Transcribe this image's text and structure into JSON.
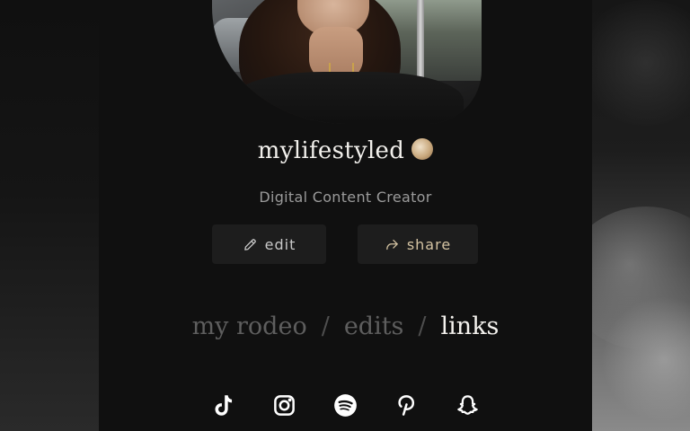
{
  "profile": {
    "username": "mylifestyled",
    "subtitle": "Digital Content Creator",
    "badge_icon": "sun-badge-icon",
    "photo": "profile-photo"
  },
  "actions": {
    "edit_label": "edit",
    "share_label": "share",
    "edit_icon": "pencil-icon",
    "share_icon": "share-arrow-icon"
  },
  "nav": {
    "items": [
      {
        "label": "my rodeo",
        "active": false
      },
      {
        "label": "edits",
        "active": false
      },
      {
        "label": "links",
        "active": true
      }
    ],
    "separator": "/"
  },
  "socials": [
    "tiktok-icon",
    "instagram-icon",
    "spotify-icon",
    "pinterest-icon",
    "snapchat-icon"
  ],
  "colors": {
    "background": "#101010",
    "button_bg": "#1d1d1d",
    "share_accent": "#d4c3a2",
    "active_nav": "#f4f2ee",
    "inactive_nav": "#5e5e5e"
  }
}
